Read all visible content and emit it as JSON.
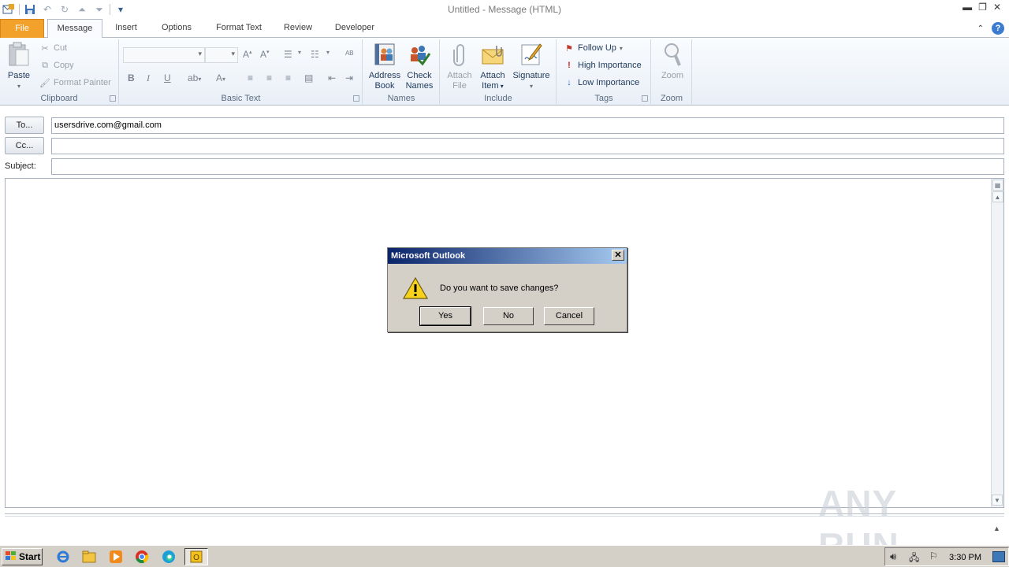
{
  "window": {
    "title": "Untitled  -  Message (HTML)"
  },
  "tabs": [
    {
      "label": "File"
    },
    {
      "label": "Message"
    },
    {
      "label": "Insert"
    },
    {
      "label": "Options"
    },
    {
      "label": "Format Text"
    },
    {
      "label": "Review"
    },
    {
      "label": "Developer"
    }
  ],
  "ribbon": {
    "clipboard": {
      "label": "Clipboard",
      "paste": "Paste",
      "cut": "Cut",
      "copy": "Copy",
      "format_painter": "Format Painter"
    },
    "basic_text": {
      "label": "Basic Text"
    },
    "names": {
      "label": "Names",
      "address_book_1": "Address",
      "address_book_2": "Book",
      "check_names_1": "Check",
      "check_names_2": "Names"
    },
    "include": {
      "label": "Include",
      "attach_file_1": "Attach",
      "attach_file_2": "File",
      "attach_item_1": "Attach",
      "attach_item_2": "Item",
      "signature": "Signature"
    },
    "tags": {
      "label": "Tags",
      "follow_up": "Follow Up",
      "high_importance": "High Importance",
      "low_importance": "Low Importance"
    },
    "zoom": {
      "label": "Zoom",
      "zoom": "Zoom"
    }
  },
  "header": {
    "to_label": "To...",
    "to_value": "usersdrive.com@gmail.com",
    "cc_label": "Cc...",
    "cc_value": "",
    "subject_label": "Subject:",
    "subject_value": ""
  },
  "dialog": {
    "title": "Microsoft Outlook",
    "message": "Do you want to save changes?",
    "yes": "Yes",
    "no": "No",
    "cancel": "Cancel"
  },
  "watermark": "ANY RUN",
  "taskbar": {
    "start": "Start",
    "clock": "3:30 PM"
  },
  "colors": {
    "file_tab": "#f2a22a",
    "dialog_title_start": "#0a246a",
    "dialog_title_end": "#a6caf0",
    "taskbar": "#d4d0c8"
  }
}
